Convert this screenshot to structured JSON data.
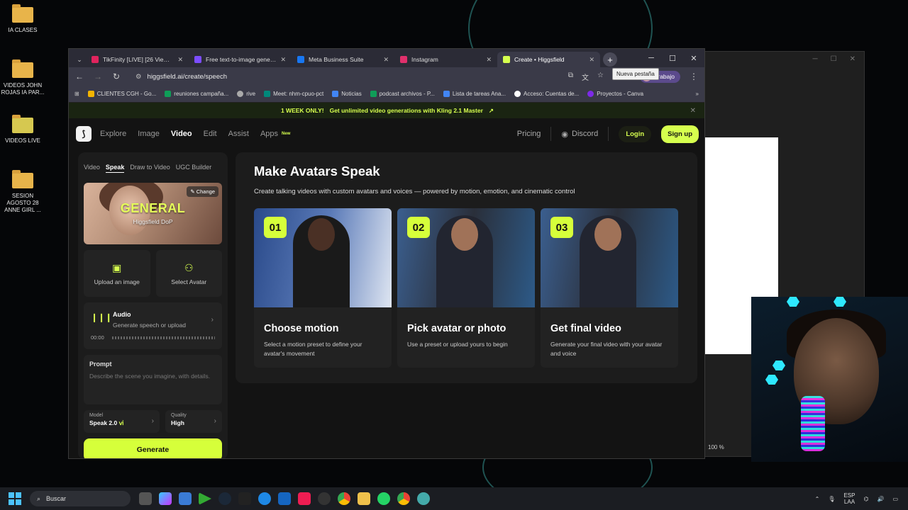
{
  "desktop": {
    "icons": [
      {
        "label": "IA CLASES"
      },
      {
        "label": "VIDEOS JOHN ROJAS IA PAR..."
      },
      {
        "label": "VIDEOS LIVE"
      },
      {
        "label": "SESION AGOSTO 28 ANNE GIRL ..."
      }
    ]
  },
  "background_window": {
    "zoom": "100 %"
  },
  "browser": {
    "tabs": [
      {
        "title": "TikFinity [LIVE] [26 Viewers]",
        "favicon_color": "#e0245e"
      },
      {
        "title": "Free text-to-image generat",
        "favicon_color": "#7c4dff"
      },
      {
        "title": "Meta Business Suite",
        "favicon_color": "#1877f2"
      },
      {
        "title": "Instagram",
        "favicon_color": "#e1306c"
      },
      {
        "title": "Create • Higgsfield",
        "favicon_color": "#d6ff4e"
      }
    ],
    "new_tab_tooltip": "Nueva pestaña",
    "url": "higgsfield.ai/create/speech",
    "profile_label": "Trabajo",
    "bookmarks": [
      {
        "label": "CLIENTES CGH - Go...",
        "color": "#f4b400"
      },
      {
        "label": "reuniones campaña...",
        "color": "#0f9d58"
      },
      {
        "label": "rive",
        "color": "#aaaaaa"
      },
      {
        "label": "Meet: nhm-cpuo-pct",
        "color": "#00897b"
      },
      {
        "label": "Noticias",
        "color": "#4285f4"
      },
      {
        "label": "podcast archivos - P...",
        "color": "#0f9d58"
      },
      {
        "label": "Lista de tareas Ana...",
        "color": "#4285f4"
      },
      {
        "label": "Acceso: Cuentas de...",
        "color": "#ffffff"
      },
      {
        "label": "Proyectos - Canva",
        "color": "#7d2ae8"
      }
    ]
  },
  "site": {
    "promo": {
      "badge": "1 WEEK ONLY!",
      "text": "Get unlimited video generations with Kling 2.1 Master",
      "arrow": "↗"
    },
    "nav": {
      "logo": "⟆",
      "links": [
        "Explore",
        "Image",
        "Video",
        "Edit",
        "Assist",
        "Apps"
      ],
      "active": "Video",
      "apps_badge": "New",
      "pricing": "Pricing",
      "discord": "Discord",
      "login": "Login",
      "signup": "Sign up"
    },
    "left": {
      "subtabs": [
        "Video",
        "Speak",
        "Draw to Video",
        "UGC Builder"
      ],
      "active_subtab": "Speak",
      "preset": {
        "title": "GENERAL",
        "subtitle": "Higgsfield DoP",
        "change": "Change"
      },
      "upload_image": "Upload an image",
      "select_avatar": "Select Avatar",
      "audio": {
        "title": "Audio",
        "subtitle": "Generate speech or upload",
        "time": "00:00"
      },
      "prompt": {
        "title": "Prompt",
        "placeholder": "Describe the scene you imagine, with details."
      },
      "model": {
        "label": "Model",
        "value": "Speak 2.0"
      },
      "quality": {
        "label": "Quality",
        "value": "High"
      },
      "generate": "Generate"
    },
    "main": {
      "title": "Make Avatars Speak",
      "subtitle": "Create talking videos with custom avatars and voices — powered by motion, emotion, and cinematic control",
      "steps": [
        {
          "num": "01",
          "title": "Choose motion",
          "desc": "Select a motion preset to define your avatar's movement"
        },
        {
          "num": "02",
          "title": "Pick avatar or photo",
          "desc": "Use a preset or upload yours to begin"
        },
        {
          "num": "03",
          "title": "Get final video",
          "desc": "Generate your final video with your avatar and voice"
        }
      ]
    }
  },
  "taskbar": {
    "search": "Buscar",
    "lang_top": "ESP",
    "lang_bottom": "LAA"
  }
}
